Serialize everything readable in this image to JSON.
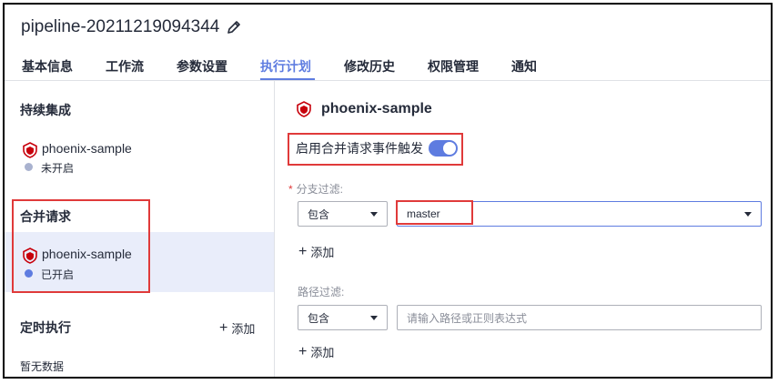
{
  "header": {
    "title": "pipeline-20211219094344"
  },
  "tabs": [
    {
      "label": "基本信息"
    },
    {
      "label": "工作流"
    },
    {
      "label": "参数设置"
    },
    {
      "label": "执行计划"
    },
    {
      "label": "修改历史"
    },
    {
      "label": "权限管理"
    },
    {
      "label": "通知"
    }
  ],
  "sidebar": {
    "ci_title": "持续集成",
    "ci_item": {
      "name": "phoenix-sample",
      "status": "未开启"
    },
    "mr_title": "合并请求",
    "mr_item": {
      "name": "phoenix-sample",
      "status": "已开启"
    },
    "timer_title": "定时执行",
    "add_label": "添加",
    "no_data": "暂无数据"
  },
  "main": {
    "title": "phoenix-sample",
    "toggle_label": "启用合并请求事件触发",
    "branch_filter": {
      "label": "分支过滤:",
      "required": "*",
      "mode": "包含",
      "value": "master"
    },
    "path_filter": {
      "label": "路径过滤:",
      "mode": "包含",
      "placeholder": "请输入路径或正则表达式"
    },
    "add_label": "添加"
  },
  "colors": {
    "accent": "#5e7ce0",
    "highlight_box": "#e03a3a",
    "status_off": "#a9b2cf",
    "status_on": "#5e7ce0"
  }
}
